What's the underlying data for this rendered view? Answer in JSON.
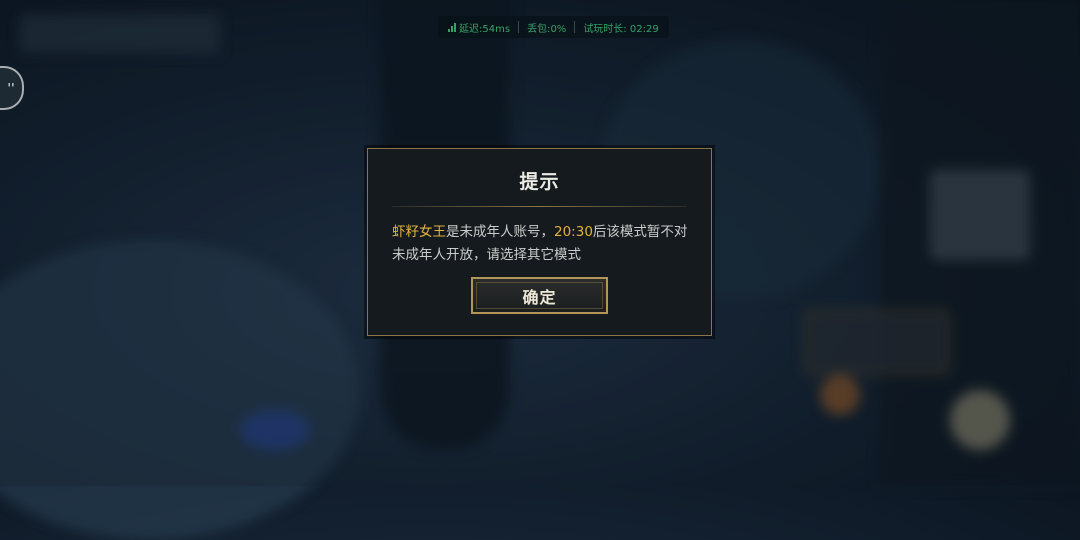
{
  "status_bar": {
    "latency_label": "延迟:",
    "latency_value": "54ms",
    "packet_loss_label": "丢包:",
    "packet_loss_value": "0%",
    "play_time_label": "试玩时长:",
    "play_time_value": "02:29",
    "color": "#3fbf7a"
  },
  "side_button": {
    "icon": "chat-bubble-icon",
    "label": "''"
  },
  "dialog": {
    "title": "提示",
    "account_name": "虾籽女王",
    "message_part1": "是未成年人账号，",
    "time": "20:30",
    "message_part2": "后该模式暂不对未成年人开放，请选择其它模式",
    "confirm_label": "确定",
    "highlight_color": "#e3b23c",
    "border_color": "#8a7546"
  }
}
